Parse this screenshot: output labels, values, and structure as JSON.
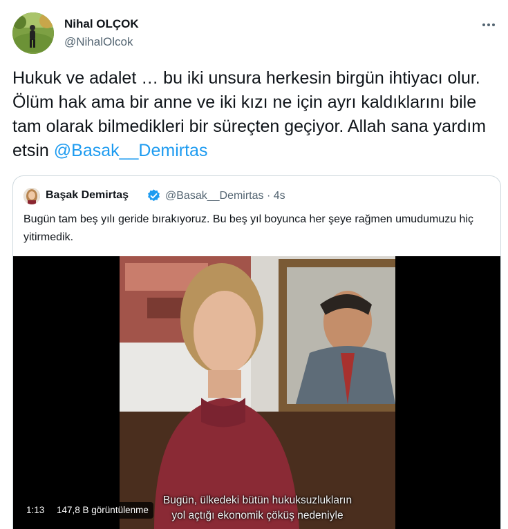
{
  "tweet": {
    "author_name": "Nihal OLÇOK",
    "author_handle": "@NihalOlcok",
    "text": "Hukuk ve adalet … bu iki unsura herkesin birgün ihtiyacı olur. Ölüm hak ama bir anne ve iki kızı ne için ayrı kaldıklarını bile tam olarak bilmedikleri bir süreçten geçiyor. Allah sana yardım etsin ",
    "mention": "@Basak__Demirtas",
    "more_icon": "more-horizontal-icon"
  },
  "quote": {
    "author_name": "Başak Demirtaş",
    "verified_icon": "verified-badge-icon",
    "meta": "@Basak__Demirtas · 4s",
    "text": "Bugün tam beş yılı geride bırakıyoruz. Bu beş yıl boyunca her şeye rağmen umudumuzu hiç yitirmedik.",
    "video": {
      "subtitle_line1": "Bugün, ülkedeki bütün hukuksuzlukların",
      "subtitle_line2": "yol açtığı ekonomik çöküş nedeniyle",
      "duration": "1:13",
      "views": "147,8 B görüntülenme"
    }
  },
  "colors": {
    "link": "#1d9bf0",
    "secondary_text": "#536471",
    "border": "#cfd9de",
    "verified": "#1d9bf0"
  }
}
